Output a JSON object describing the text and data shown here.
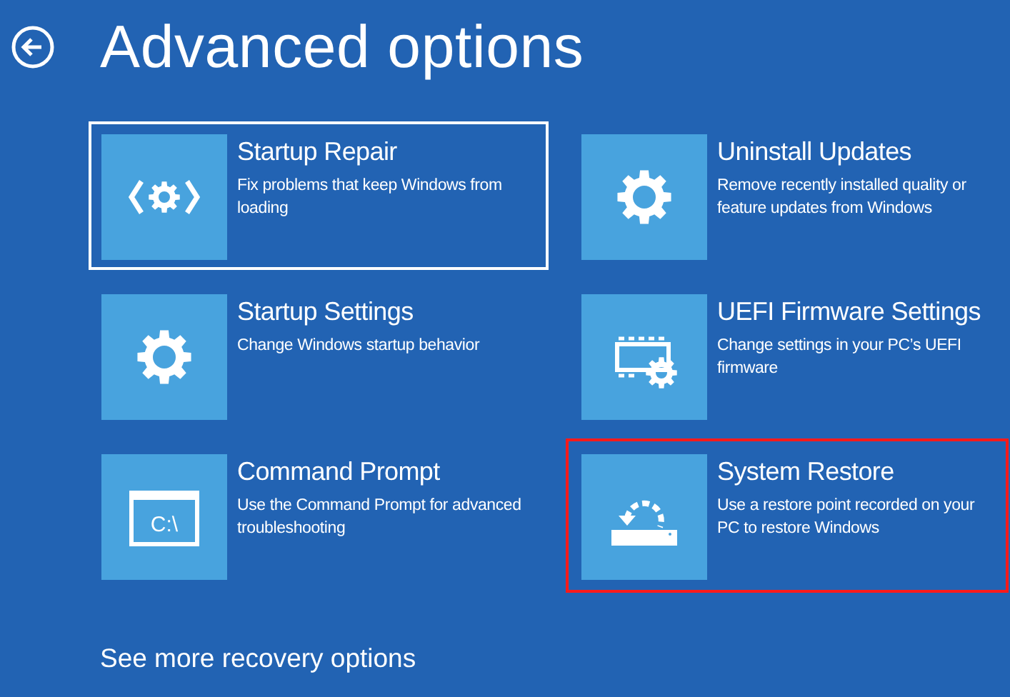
{
  "title": "Advanced options",
  "options": [
    {
      "title": "Startup Repair",
      "description": "Fix problems that keep Windows from loading",
      "kind": "repair",
      "selected": true,
      "highlighted": false
    },
    {
      "title": "Uninstall Updates",
      "description": "Remove recently installed quality or feature updates from Windows",
      "kind": "gear",
      "selected": false,
      "highlighted": false
    },
    {
      "title": "Startup Settings",
      "description": "Change Windows startup behavior",
      "kind": "gear",
      "selected": false,
      "highlighted": false
    },
    {
      "title": "UEFI Firmware Settings",
      "description": "Change settings in your PC’s UEFI firmware",
      "kind": "chip",
      "selected": false,
      "highlighted": false
    },
    {
      "title": "Command Prompt",
      "description": "Use the Command Prompt for advanced troubleshooting",
      "kind": "console",
      "icon_text": "C:\\",
      "selected": false,
      "highlighted": false
    },
    {
      "title": "System Restore",
      "description": "Use a restore point recorded on your PC to restore Windows",
      "kind": "restore",
      "selected": false,
      "highlighted": true
    }
  ],
  "more_link": "See more recovery options"
}
